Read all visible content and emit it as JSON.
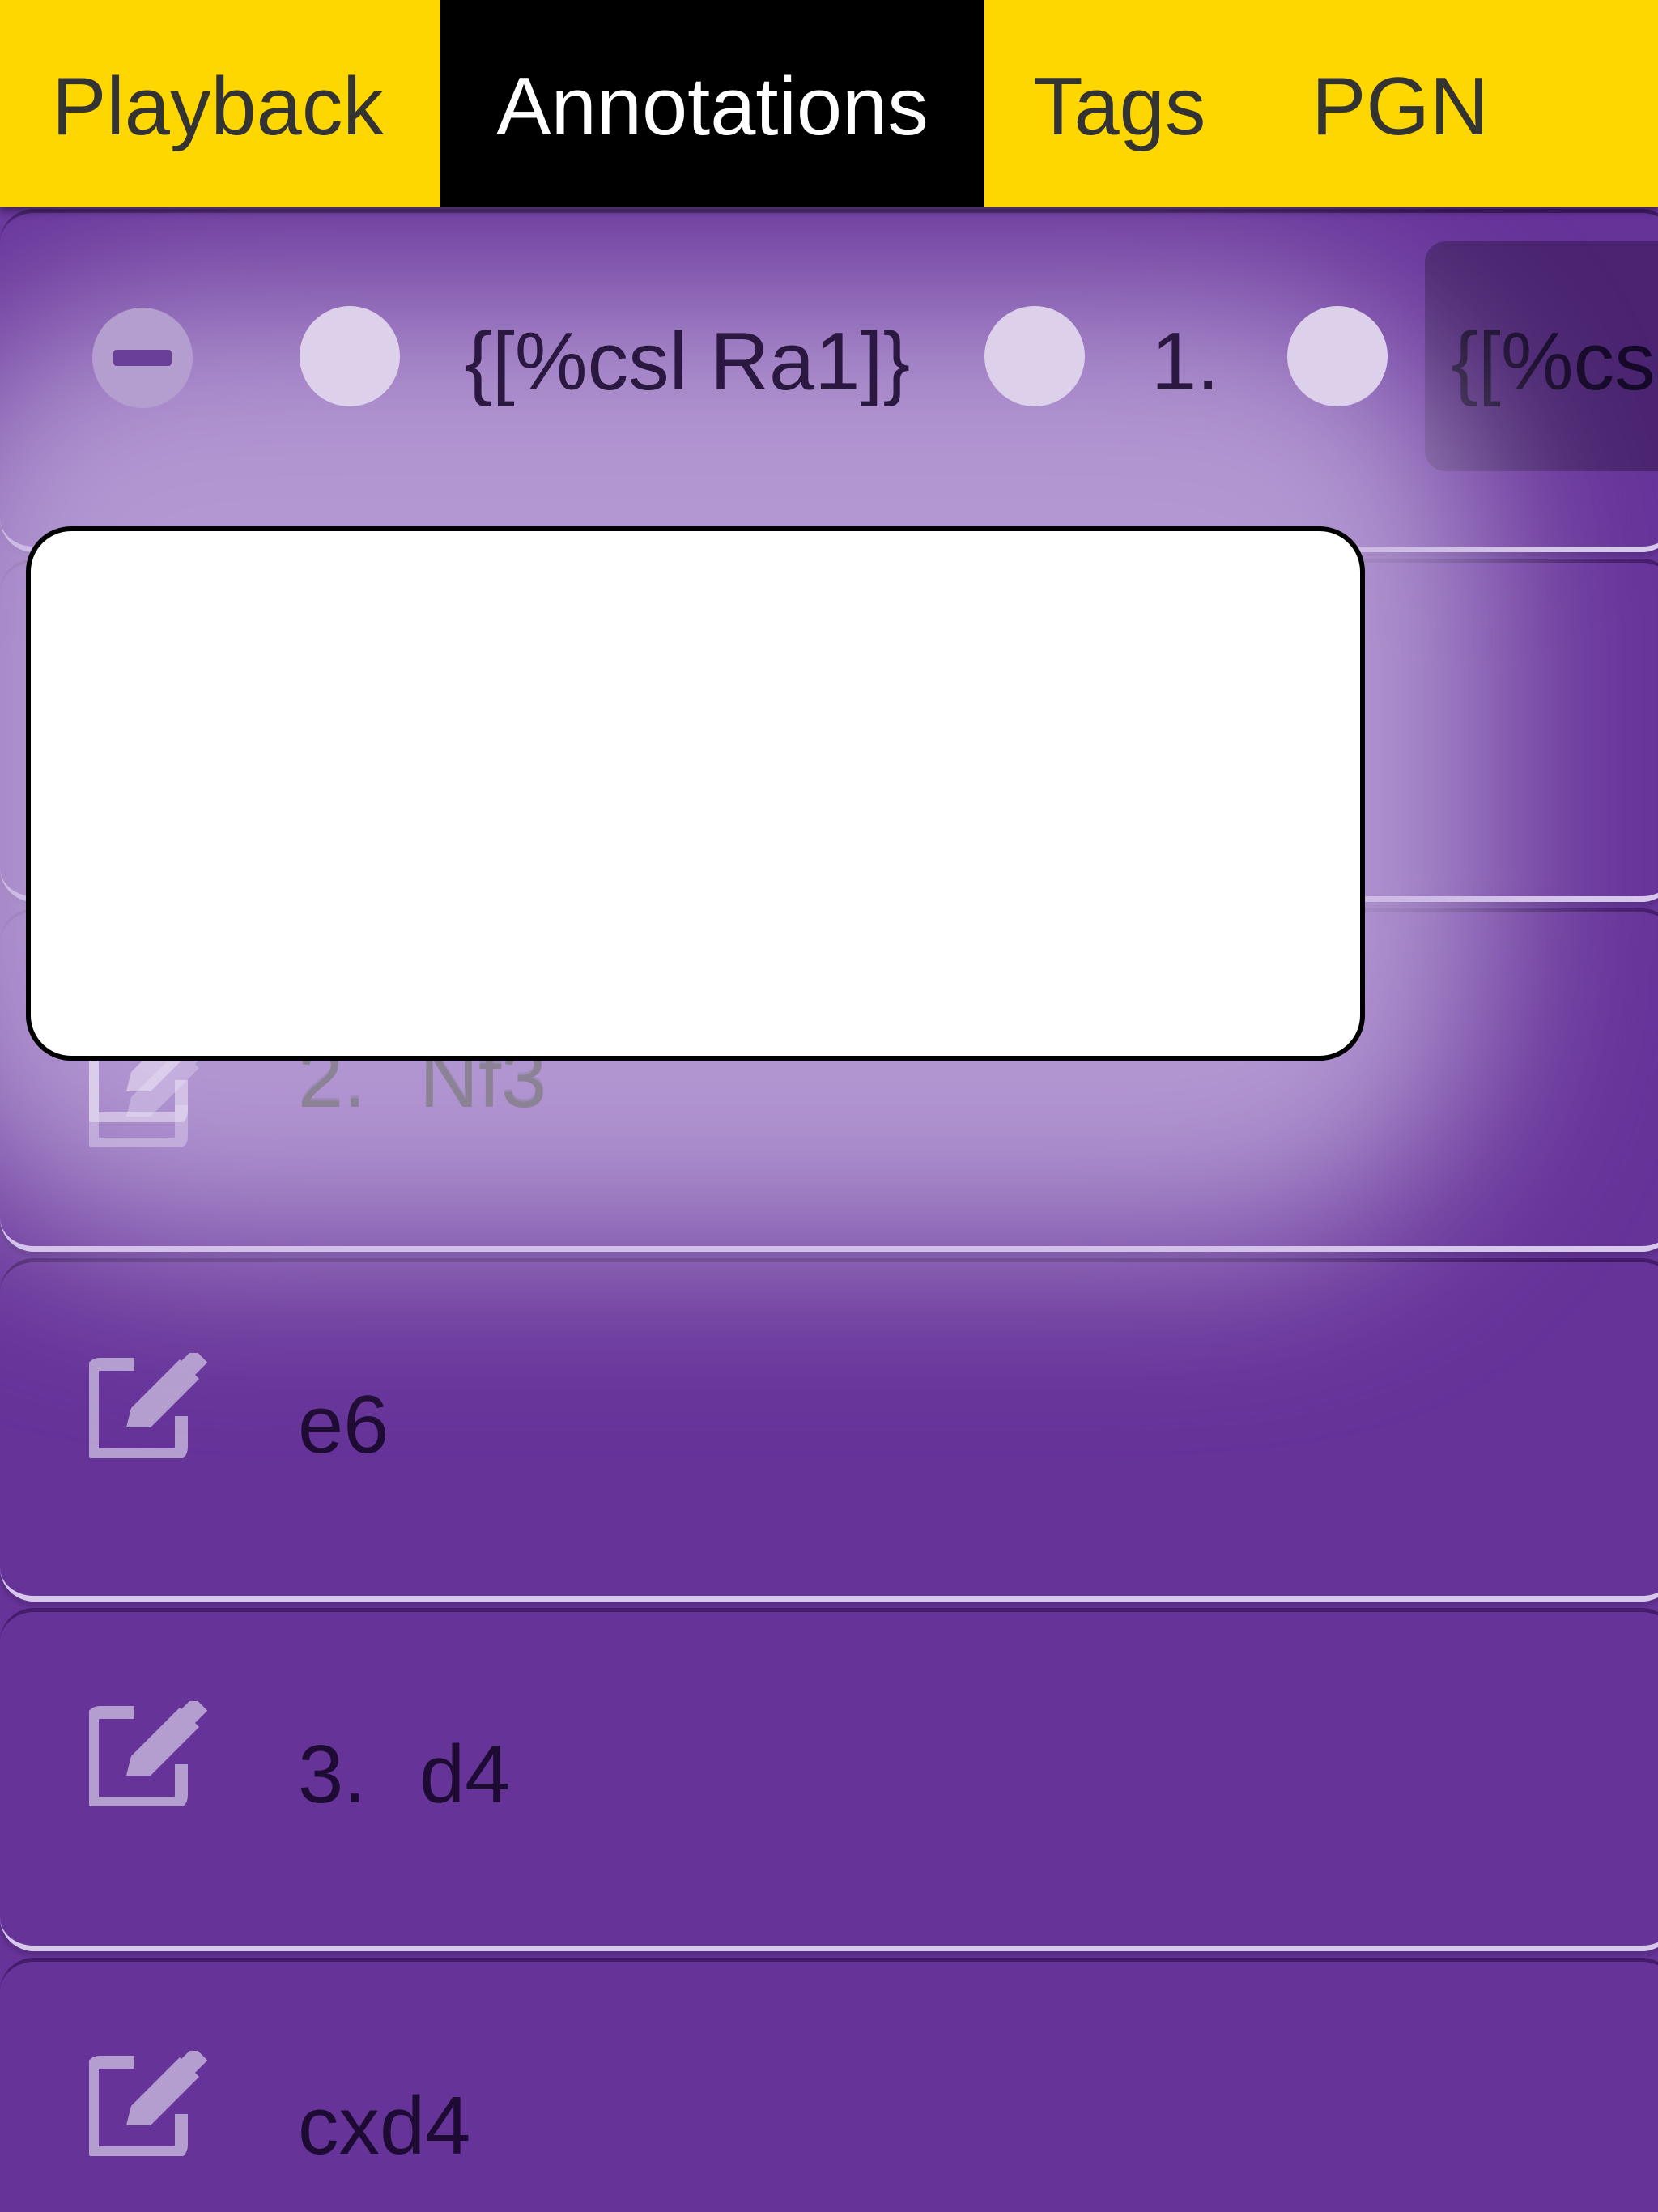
{
  "tabs": [
    {
      "label": "Playback",
      "active": false
    },
    {
      "label": "Annotations",
      "active": true
    },
    {
      "label": "Tags",
      "active": false
    },
    {
      "label": "PGN",
      "active": false
    }
  ],
  "colors": {
    "tabbar": "#FFD700",
    "active_tab": "#000000",
    "row_bg": "#663399",
    "icon": "#b49ed0"
  },
  "comment_row": {
    "comment_before": "{[%csl Ra1]}",
    "move_number": "1.",
    "comment_after": "{[%csl"
  },
  "comment_input": {
    "value": "",
    "placeholder": ""
  },
  "moves": [
    {
      "number": "2.",
      "san": "Nf3",
      "icon": "edit-icon"
    },
    {
      "number": "",
      "san": "e6",
      "icon": "edit-icon"
    },
    {
      "number": "3.",
      "san": "d4",
      "icon": "edit-icon"
    },
    {
      "number": "",
      "san": "cxd4",
      "icon": "edit-icon"
    }
  ]
}
